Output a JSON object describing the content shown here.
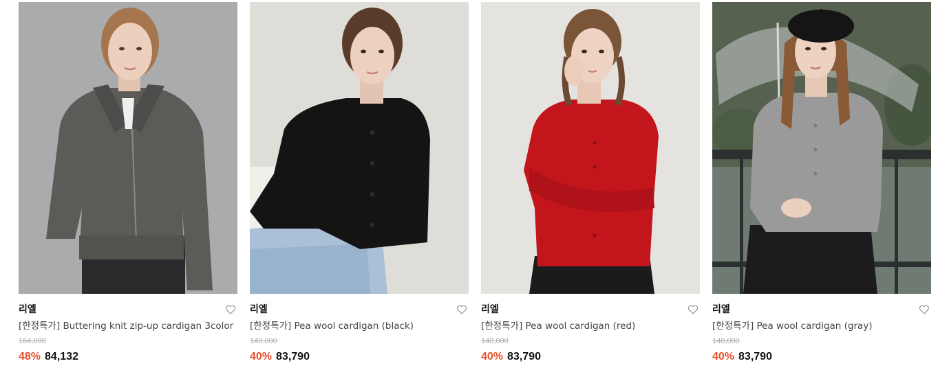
{
  "products": [
    {
      "brand": "리엘",
      "title": "[한정특가] Buttering knit zip-up cardigan 3color",
      "original_price": "164,000",
      "discount": "48%",
      "price": "84,132",
      "garment_color": "#5c5b58"
    },
    {
      "brand": "리엘",
      "title": "[한정특가] Pea wool cardigan (black)",
      "original_price": "140,000",
      "discount": "40%",
      "price": "83,790",
      "garment_color": "#141414"
    },
    {
      "brand": "리엘",
      "title": "[한정특가] Pea wool cardigan (red)",
      "original_price": "140,000",
      "discount": "40%",
      "price": "83,790",
      "garment_color": "#c3161c"
    },
    {
      "brand": "리엘",
      "title": "[한정특가] Pea wool cardigan (gray)",
      "original_price": "140,000",
      "discount": "40%",
      "price": "83,790",
      "garment_color": "#9a9a9a"
    }
  ],
  "colors": {
    "discount": "#e8502d",
    "price": "#111111",
    "original_price": "#aaaaaa"
  },
  "icons": {
    "wishlist": "heart-outline-icon"
  }
}
